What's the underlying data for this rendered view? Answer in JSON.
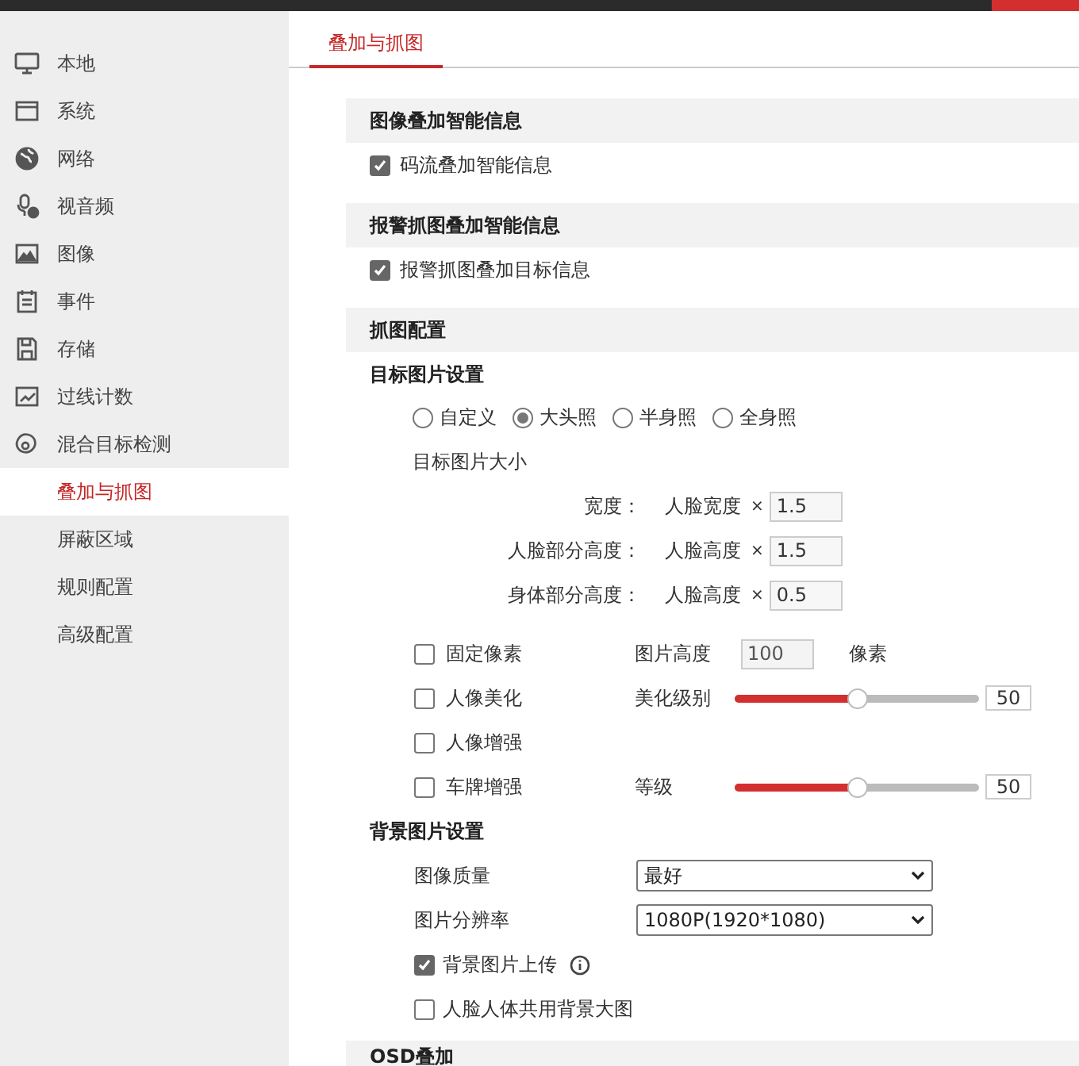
{
  "sidebar": {
    "items": [
      {
        "kind": "main",
        "label": "本地",
        "selected": false
      },
      {
        "kind": "main",
        "label": "系统",
        "selected": false
      },
      {
        "kind": "main",
        "label": "网络",
        "selected": false
      },
      {
        "kind": "main",
        "label": "视音频",
        "selected": false
      },
      {
        "kind": "main",
        "label": "图像",
        "selected": false
      },
      {
        "kind": "main",
        "label": "事件",
        "selected": false
      },
      {
        "kind": "main",
        "label": "存储",
        "selected": false
      },
      {
        "kind": "main",
        "label": "过线计数",
        "selected": false
      },
      {
        "kind": "main",
        "label": "混合目标检测",
        "selected": false
      },
      {
        "kind": "sub",
        "label": "叠加与抓图",
        "selected": true
      },
      {
        "kind": "sub",
        "label": "屏蔽区域",
        "selected": false
      },
      {
        "kind": "sub",
        "label": "规则配置",
        "selected": false
      },
      {
        "kind": "sub",
        "label": "高级配置",
        "selected": false
      }
    ]
  },
  "tabs": [
    {
      "label": "叠加与抓图",
      "selected": true
    }
  ],
  "sections": [
    {
      "title": "图像叠加智能信息",
      "checks": [
        {
          "label": "码流叠加智能信息",
          "checked": true
        }
      ]
    },
    {
      "title": "报警抓图叠加智能信息",
      "checks": [
        {
          "label": "报警抓图叠加目标信息",
          "checked": true
        }
      ]
    }
  ],
  "capture": {
    "title": "抓图配置",
    "target": {
      "title": "目标图片设置",
      "modes": [
        {
          "label": "自定义",
          "selected": false
        },
        {
          "label": "大头照",
          "selected": true
        },
        {
          "label": "半身照",
          "selected": false
        },
        {
          "label": "全身照",
          "selected": false
        }
      ],
      "size_title": "目标图片大小",
      "size_rows": [
        {
          "label": "宽度：",
          "base": "人脸宽度",
          "times": "×",
          "value": "1.5"
        },
        {
          "label": "人脸部分高度：",
          "base": "人脸高度",
          "times": "×",
          "value": "1.5"
        },
        {
          "label": "身体部分高度：",
          "base": "人脸高度",
          "times": "×",
          "value": "0.5"
        }
      ],
      "options": [
        {
          "kind": "field",
          "label": "固定像素",
          "checked": false,
          "field_label": "图片高度",
          "value": "100",
          "unit": "像素"
        },
        {
          "kind": "slider",
          "label": "人像美化",
          "checked": false,
          "field_label": "美化级别",
          "level": 0.5,
          "reading": "50"
        },
        {
          "kind": "plain",
          "label": "人像增强",
          "checked": false
        },
        {
          "kind": "slider",
          "label": "车牌增强",
          "checked": false,
          "field_label": "等级",
          "level": 0.5,
          "reading": "50"
        }
      ]
    },
    "background": {
      "title": "背景图片设置",
      "selects": [
        {
          "label": "图像质量",
          "value": "最好"
        },
        {
          "label": "图片分辨率",
          "value": "1080P(1920*1080)"
        }
      ],
      "checks": [
        {
          "label": "背景图片上传",
          "checked": true,
          "info": true
        },
        {
          "label": "人脸人体共用背景大图",
          "checked": false,
          "info": false
        }
      ]
    }
  },
  "osd": {
    "title": "OSD叠加"
  }
}
